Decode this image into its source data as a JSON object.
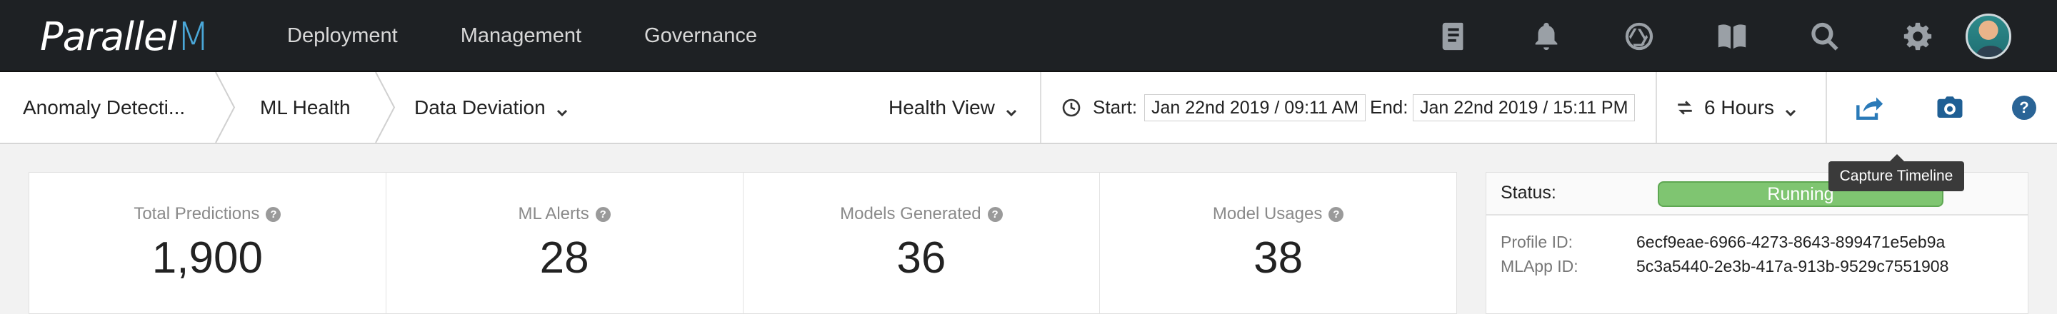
{
  "app": {
    "logo_main": "Parallel",
    "logo_accent": "M"
  },
  "nav": {
    "links": [
      "Deployment",
      "Management",
      "Governance"
    ],
    "icons": [
      "book-icon",
      "bell-icon",
      "aperture-icon",
      "map-book-icon",
      "search-icon",
      "gear-icon"
    ]
  },
  "breadcrumb": {
    "items": [
      "Anomaly Detecti...",
      "ML Health",
      "Data Deviation"
    ]
  },
  "view": {
    "selected": "Health View"
  },
  "time": {
    "start_label": "Start:",
    "start_value": "Jan 22nd 2019 / 09:11 AM",
    "end_label": "End:",
    "end_value": "Jan 22nd 2019 / 15:11 PM",
    "range": "6 Hours"
  },
  "tooltip": {
    "text": "Capture Timeline"
  },
  "stats": [
    {
      "label": "Total Predictions",
      "value": "1,900"
    },
    {
      "label": "ML Alerts",
      "value": "28"
    },
    {
      "label": "Models Generated",
      "value": "36"
    },
    {
      "label": "Model Usages",
      "value": "38"
    }
  ],
  "status": {
    "label": "Status:",
    "value": "Running",
    "profile_label": "Profile ID:",
    "profile_id": "6ecf9eae-6966-4273-8643-899471e5eb9a",
    "mlapp_label": "MLApp ID:",
    "mlapp_id": "5c3a5440-2e3b-417a-913b-9529c7551908"
  },
  "colors": {
    "nav_bg": "#1e2124",
    "accent_blue": "#2a7ab8",
    "running_green": "#7fc571"
  }
}
